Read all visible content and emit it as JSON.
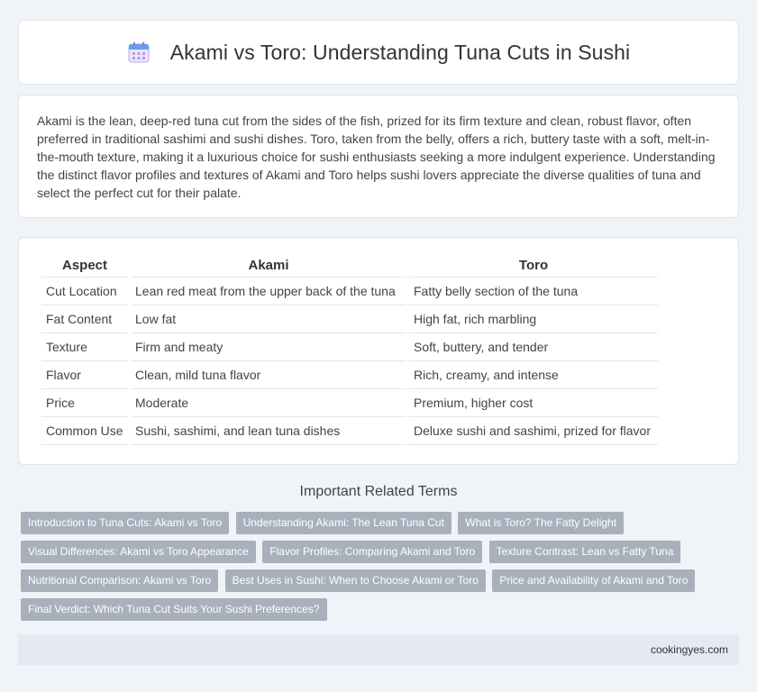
{
  "header": {
    "icon": "calendar-icon",
    "title": "Akami vs Toro: Understanding Tuna Cuts in Sushi"
  },
  "intro": {
    "text": "Akami is the lean, deep-red tuna cut from the sides of the fish, prized for its firm texture and clean, robust flavor, often preferred in traditional sashimi and sushi dishes. Toro, taken from the belly, offers a rich, buttery taste with a soft, melt-in-the-mouth texture, making it a luxurious choice for sushi enthusiasts seeking a more indulgent experience. Understanding the distinct flavor profiles and textures of Akami and Toro helps sushi lovers appreciate the diverse qualities of tuna and select the perfect cut for their palate."
  },
  "table": {
    "headers": [
      "Aspect",
      "Akami",
      "Toro"
    ],
    "rows": [
      [
        "Cut Location",
        "Lean red meat from the upper back of the tuna",
        "Fatty belly section of the tuna"
      ],
      [
        "Fat Content",
        "Low fat",
        "High fat, rich marbling"
      ],
      [
        "Texture",
        "Firm and meaty",
        "Soft, buttery, and tender"
      ],
      [
        "Flavor",
        "Clean, mild tuna flavor",
        "Rich, creamy, and intense"
      ],
      [
        "Price",
        "Moderate",
        "Premium, higher cost"
      ],
      [
        "Common Use",
        "Sushi, sashimi, and lean tuna dishes",
        "Deluxe sushi and sashimi, prized for flavor"
      ]
    ]
  },
  "related": {
    "title": "Important Related Terms",
    "tags": [
      "Introduction to Tuna Cuts: Akami vs Toro",
      "Understanding Akami: The Lean Tuna Cut",
      "What is Toro? The Fatty Delight",
      "Visual Differences: Akami vs Toro Appearance",
      "Flavor Profiles: Comparing Akami and Toro",
      "Texture Contrast: Lean vs Fatty Tuna",
      "Nutritional Comparison: Akami vs Toro",
      "Best Uses in Sushi: When to Choose Akami or Toro",
      "Price and Availability of Akami and Toro",
      "Final Verdict: Which Tuna Cut Suits Your Sushi Preferences?"
    ]
  },
  "footer": {
    "site": "cookingyes.com"
  },
  "colors": {
    "background": "#f0f3f8",
    "tag": "#a8b0bc",
    "footer": "#e4e9f3"
  }
}
